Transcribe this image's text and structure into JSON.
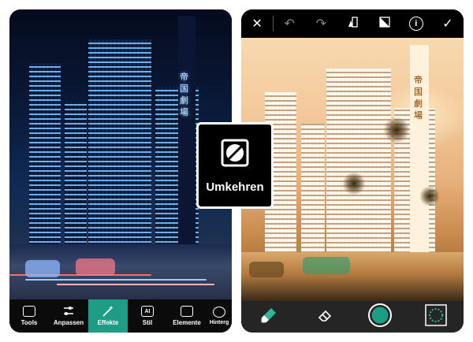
{
  "left_toolbar": {
    "items": [
      {
        "label": "Tools",
        "icon": "image-tools-icon",
        "active": false
      },
      {
        "label": "Anpassen",
        "icon": "sliders-icon",
        "active": false
      },
      {
        "label": "Effekte",
        "icon": "magic-wand-icon",
        "active": true
      },
      {
        "label": "Stil",
        "icon": "ai-icon",
        "active": false
      },
      {
        "label": "Elemente",
        "icon": "sticker-icon",
        "active": false
      },
      {
        "label": "Hinterg",
        "icon": "background-icon",
        "active": false
      }
    ],
    "ai_icon_text": "AI"
  },
  "right_topbar": {
    "buttons": [
      "close-icon",
      "undo-icon",
      "redo-icon",
      "compare-icon",
      "eraser-mask-icon",
      "info-icon",
      "check-icon"
    ],
    "close_glyph": "✕",
    "undo_glyph": "↶",
    "redo_glyph": "↷",
    "info_glyph": "i",
    "check_glyph": "✓"
  },
  "right_bottombar": {
    "buttons": [
      "brush-icon",
      "eraser-icon",
      "brush-size-icon",
      "selection-icon"
    ]
  },
  "overlay": {
    "label": "Umkehren",
    "icon": "invert-icon"
  },
  "sign_text": {
    "chars": [
      "帝",
      "国",
      "劇",
      "場"
    ]
  },
  "colors": {
    "accent": "#1f9c86",
    "toolbar_bg": "#0b0b0b",
    "bottombar_bg": "#252525"
  }
}
